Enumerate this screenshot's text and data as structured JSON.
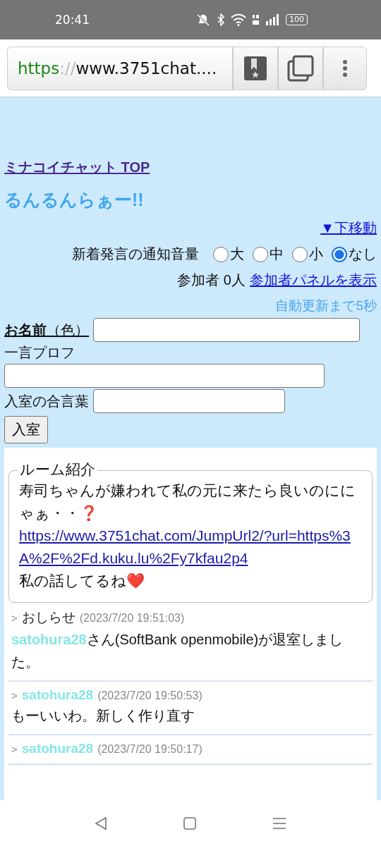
{
  "status_bar": {
    "time": "20:41",
    "battery": "100"
  },
  "browser": {
    "url_scheme": "https",
    "url_separator": "://",
    "url_rest": "www.3751chat...."
  },
  "page": {
    "top_link": "ミナコイチャット TOP",
    "room_title": "るんるんらぁー!!",
    "move_down_link": "▼下移動",
    "volume": {
      "label": "新着発言の通知音量",
      "options": [
        {
          "label": "大",
          "selected": false
        },
        {
          "label": "中",
          "selected": false
        },
        {
          "label": "小",
          "selected": false
        },
        {
          "label": "なし",
          "selected": true
        }
      ]
    },
    "participants": "参加者 0人",
    "participant_panel_link": "参加者パネルを表示",
    "auto_update": "自動更新まで5秒",
    "form": {
      "fields": [
        {
          "label": "**お名前**（色）",
          "kind": "inline"
        },
        {
          "label": "一言プロフ",
          "kind": "stacked"
        },
        {
          "label": "入室の合言葉",
          "kind": "inline"
        }
      ],
      "enter_button": "入室"
    },
    "room_intro": {
      "legend": "ルーム紹介",
      "text": "寿司ちゃんが嫌われて私の元に来たら良いのににゃぁ・・❓",
      "link": "https://www.3751chat.com/JumpUrl2/?url=https%3A%2F%2Fd.kuku.lu%2Fy7kfau2p4",
      "text_after": "私の話してるね❤️"
    },
    "messages": [
      {
        "marker": ">",
        "author": "おしらせ",
        "color": "#222222",
        "time": "(2023/7/20 19:51:03)",
        "body_name": "satohura28",
        "body": "さん(SoftBank openmobile)が退室しました。"
      },
      {
        "marker": ">",
        "author": "satohura28",
        "color": "#86e6e6",
        "time": "(2023/7/20 19:50:53)",
        "body": "もーいいわ。新しく作り直す"
      },
      {
        "marker": ">",
        "author": "satohura28",
        "color": "#86e6e6",
        "time": "(2023/7/20 19:50:17)"
      }
    ]
  }
}
